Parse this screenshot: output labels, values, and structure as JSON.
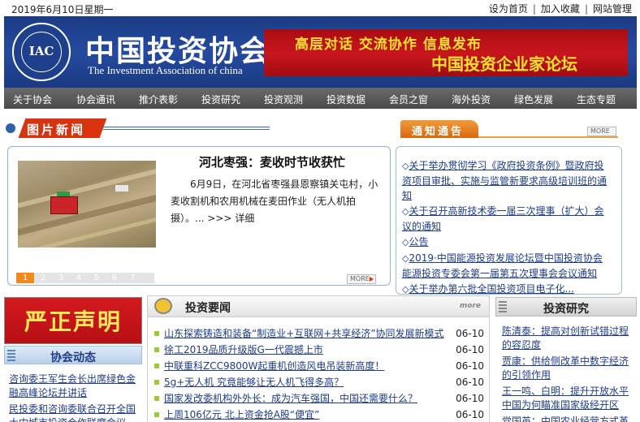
{
  "topbar": {
    "date": "2019年6月10日星期一",
    "links": [
      "设为首页",
      "加入收藏",
      "网站管理"
    ]
  },
  "header": {
    "logo_abbr": "IAC",
    "logo_cn": "中国投资协会",
    "logo_en": "The Investment Association of china",
    "banner_line1": "高层对话  交流协作  信息发布",
    "banner_line2": "中国投资企业家论坛"
  },
  "nav": [
    "关于协会",
    "协会通讯",
    "推介表彰",
    "投资研究",
    "投资观测",
    "投资数据",
    "会员之窗",
    "海外投资",
    "绿色发展",
    "生态专题"
  ],
  "picture_news": {
    "section_title": "图片新闻",
    "headline": "河北枣强：麦收时节收获忙",
    "body": "6月9日，在河北省枣强县恩察镇关屯村，小麦收割机和农用机械在麦田作业（无人机拍摄）。...",
    "detail_link": ">>> 详细",
    "pages": [
      "1",
      "2",
      "3",
      "4",
      "5",
      "6",
      "7"
    ],
    "more": "MORE"
  },
  "notice": {
    "section_title": "通知通告",
    "more": "MORE",
    "items": [
      "关于举办贯彻学习《政府投资条例》暨政府投资项目审批、实施与监管新要求高级培训班的通知",
      "关于召开高新技术委一届三次理事（扩大）会议的通知",
      "公告",
      "2019·中国能源投资发展论坛暨中国投资协会能源投资专委会第一届第五次理事会会议通知",
      "关于举办第六批全国投资项目电子化..."
    ]
  },
  "statement": {
    "label": "严正声明"
  },
  "association_news": {
    "section_title": "协会动态",
    "items": [
      "咨询委王军生会长出席绿色金融高峰论坛并讲话",
      "民投委和咨询委联合召开全国大中城市投资合作联席会议"
    ]
  },
  "investment_news": {
    "section_title": "投资要闻",
    "more": "more",
    "items": [
      {
        "title": "山东探索铸造和装备“制造业+互联网+共享经济”协同发展新模式",
        "date": "06-10"
      },
      {
        "title": "徐工2019品质升级版G一代震撼上市",
        "date": "06-10"
      },
      {
        "title": "中联重科ZCC9800W起重机创造风电吊装新高度！",
        "date": "06-10"
      },
      {
        "title": "5g+无人机 究竟能够让无人机飞得多高？",
        "date": "06-10"
      },
      {
        "title": "国家发改委机构外外长：成为汽车强国，中国还需要什么？",
        "date": "06-10"
      },
      {
        "title": "上周106亿元 北上资金抢A股“便宜”",
        "date": "06-10"
      }
    ]
  },
  "research": {
    "section_title": "投资研究",
    "items": [
      "陈清泰：提高对创新试错过程的容忍度",
      "贾康：供给侧改革中数字经济的引领作用",
      "王一鸣、白明：提升开放水平 中国为何瞄准国家级经开区",
      "党国英：中国农业经营方式革"
    ]
  }
}
